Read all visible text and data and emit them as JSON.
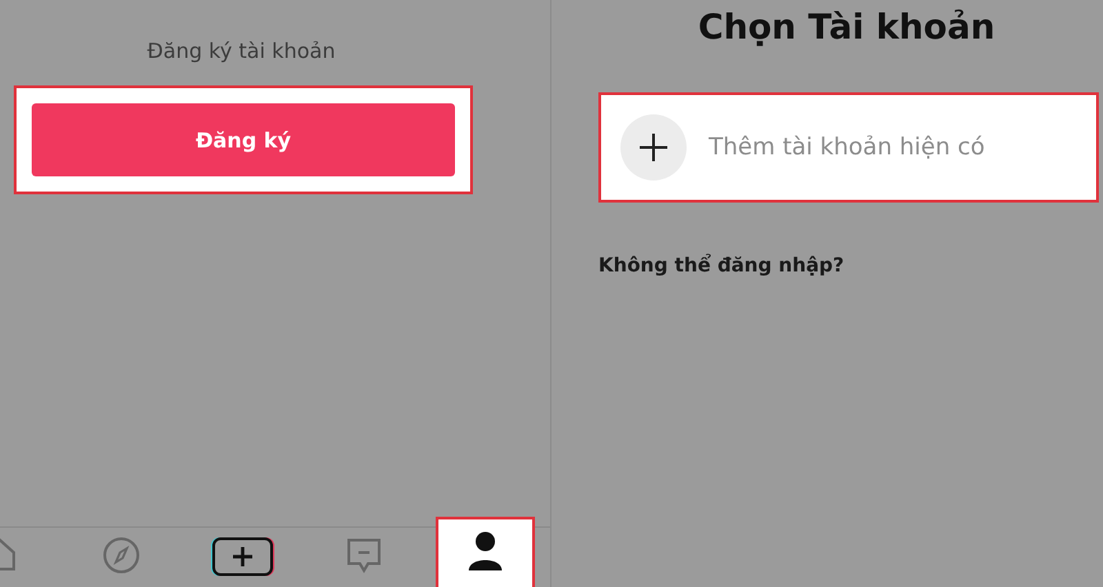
{
  "signup_panel": {
    "heading": "Đăng ký tài khoản",
    "button": "Đăng ký"
  },
  "account_panel": {
    "title": "Chọn Tài khoản",
    "add_account": "Thêm tài khoản hiện có",
    "help_link": "Không thể đăng nhập?"
  },
  "tab_bar": [
    {
      "kind": "home",
      "selected": false
    },
    {
      "kind": "explore",
      "selected": false
    },
    {
      "kind": "create",
      "selected": false
    },
    {
      "kind": "inbox",
      "selected": false
    },
    {
      "kind": "profile",
      "selected": true
    }
  ]
}
